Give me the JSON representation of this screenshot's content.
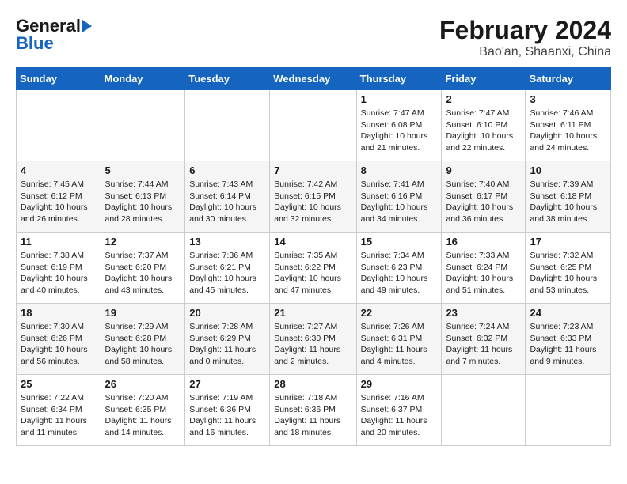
{
  "header": {
    "logo_line1": "General",
    "logo_line2": "Blue",
    "month_year": "February 2024",
    "location": "Bao'an, Shaanxi, China"
  },
  "days_of_week": [
    "Sunday",
    "Monday",
    "Tuesday",
    "Wednesday",
    "Thursday",
    "Friday",
    "Saturday"
  ],
  "weeks": [
    [
      {
        "num": "",
        "detail": ""
      },
      {
        "num": "",
        "detail": ""
      },
      {
        "num": "",
        "detail": ""
      },
      {
        "num": "",
        "detail": ""
      },
      {
        "num": "1",
        "detail": "Sunrise: 7:47 AM\nSunset: 6:08 PM\nDaylight: 10 hours\nand 21 minutes."
      },
      {
        "num": "2",
        "detail": "Sunrise: 7:47 AM\nSunset: 6:10 PM\nDaylight: 10 hours\nand 22 minutes."
      },
      {
        "num": "3",
        "detail": "Sunrise: 7:46 AM\nSunset: 6:11 PM\nDaylight: 10 hours\nand 24 minutes."
      }
    ],
    [
      {
        "num": "4",
        "detail": "Sunrise: 7:45 AM\nSunset: 6:12 PM\nDaylight: 10 hours\nand 26 minutes."
      },
      {
        "num": "5",
        "detail": "Sunrise: 7:44 AM\nSunset: 6:13 PM\nDaylight: 10 hours\nand 28 minutes."
      },
      {
        "num": "6",
        "detail": "Sunrise: 7:43 AM\nSunset: 6:14 PM\nDaylight: 10 hours\nand 30 minutes."
      },
      {
        "num": "7",
        "detail": "Sunrise: 7:42 AM\nSunset: 6:15 PM\nDaylight: 10 hours\nand 32 minutes."
      },
      {
        "num": "8",
        "detail": "Sunrise: 7:41 AM\nSunset: 6:16 PM\nDaylight: 10 hours\nand 34 minutes."
      },
      {
        "num": "9",
        "detail": "Sunrise: 7:40 AM\nSunset: 6:17 PM\nDaylight: 10 hours\nand 36 minutes."
      },
      {
        "num": "10",
        "detail": "Sunrise: 7:39 AM\nSunset: 6:18 PM\nDaylight: 10 hours\nand 38 minutes."
      }
    ],
    [
      {
        "num": "11",
        "detail": "Sunrise: 7:38 AM\nSunset: 6:19 PM\nDaylight: 10 hours\nand 40 minutes."
      },
      {
        "num": "12",
        "detail": "Sunrise: 7:37 AM\nSunset: 6:20 PM\nDaylight: 10 hours\nand 43 minutes."
      },
      {
        "num": "13",
        "detail": "Sunrise: 7:36 AM\nSunset: 6:21 PM\nDaylight: 10 hours\nand 45 minutes."
      },
      {
        "num": "14",
        "detail": "Sunrise: 7:35 AM\nSunset: 6:22 PM\nDaylight: 10 hours\nand 47 minutes."
      },
      {
        "num": "15",
        "detail": "Sunrise: 7:34 AM\nSunset: 6:23 PM\nDaylight: 10 hours\nand 49 minutes."
      },
      {
        "num": "16",
        "detail": "Sunrise: 7:33 AM\nSunset: 6:24 PM\nDaylight: 10 hours\nand 51 minutes."
      },
      {
        "num": "17",
        "detail": "Sunrise: 7:32 AM\nSunset: 6:25 PM\nDaylight: 10 hours\nand 53 minutes."
      }
    ],
    [
      {
        "num": "18",
        "detail": "Sunrise: 7:30 AM\nSunset: 6:26 PM\nDaylight: 10 hours\nand 56 minutes."
      },
      {
        "num": "19",
        "detail": "Sunrise: 7:29 AM\nSunset: 6:28 PM\nDaylight: 10 hours\nand 58 minutes."
      },
      {
        "num": "20",
        "detail": "Sunrise: 7:28 AM\nSunset: 6:29 PM\nDaylight: 11 hours\nand 0 minutes."
      },
      {
        "num": "21",
        "detail": "Sunrise: 7:27 AM\nSunset: 6:30 PM\nDaylight: 11 hours\nand 2 minutes."
      },
      {
        "num": "22",
        "detail": "Sunrise: 7:26 AM\nSunset: 6:31 PM\nDaylight: 11 hours\nand 4 minutes."
      },
      {
        "num": "23",
        "detail": "Sunrise: 7:24 AM\nSunset: 6:32 PM\nDaylight: 11 hours\nand 7 minutes."
      },
      {
        "num": "24",
        "detail": "Sunrise: 7:23 AM\nSunset: 6:33 PM\nDaylight: 11 hours\nand 9 minutes."
      }
    ],
    [
      {
        "num": "25",
        "detail": "Sunrise: 7:22 AM\nSunset: 6:34 PM\nDaylight: 11 hours\nand 11 minutes."
      },
      {
        "num": "26",
        "detail": "Sunrise: 7:20 AM\nSunset: 6:35 PM\nDaylight: 11 hours\nand 14 minutes."
      },
      {
        "num": "27",
        "detail": "Sunrise: 7:19 AM\nSunset: 6:36 PM\nDaylight: 11 hours\nand 16 minutes."
      },
      {
        "num": "28",
        "detail": "Sunrise: 7:18 AM\nSunset: 6:36 PM\nDaylight: 11 hours\nand 18 minutes."
      },
      {
        "num": "29",
        "detail": "Sunrise: 7:16 AM\nSunset: 6:37 PM\nDaylight: 11 hours\nand 20 minutes."
      },
      {
        "num": "",
        "detail": ""
      },
      {
        "num": "",
        "detail": ""
      }
    ]
  ]
}
